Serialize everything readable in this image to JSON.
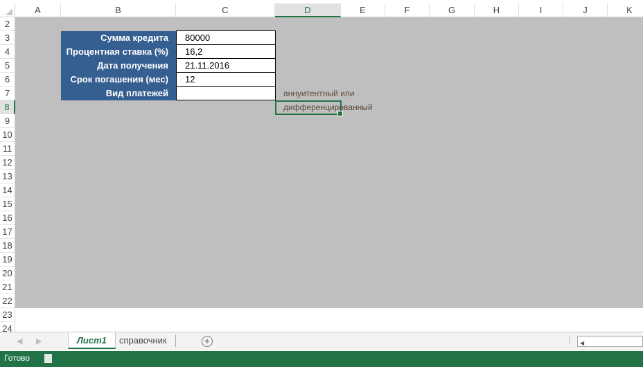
{
  "columns": [
    "A",
    "B",
    "C",
    "D",
    "E",
    "F",
    "G",
    "H",
    "I",
    "J",
    "K"
  ],
  "rows": [
    "2",
    "3",
    "4",
    "5",
    "6",
    "7",
    "8",
    "9",
    "10",
    "11",
    "12",
    "13",
    "14",
    "15",
    "16",
    "17",
    "18",
    "19",
    "20",
    "21",
    "22",
    "23",
    "24"
  ],
  "form": {
    "labels": [
      "Сумма кредита",
      "Процентная ставка (%)",
      "Дата получения",
      "Срок погашения (мес)",
      "Вид платежей"
    ],
    "values": [
      "80000",
      "16,2",
      "21.11.2016",
      "12",
      ""
    ]
  },
  "notes": {
    "d7": "аннуитентный  или",
    "d8": "дифференцированный"
  },
  "sheets": {
    "tab1": "Лист1",
    "tab2": "справочник",
    "add": "+"
  },
  "status": {
    "text": "Готово"
  },
  "colors": {
    "header_fill": "#365f91",
    "accent": "#217346",
    "overlay": "#bfbfbf"
  }
}
